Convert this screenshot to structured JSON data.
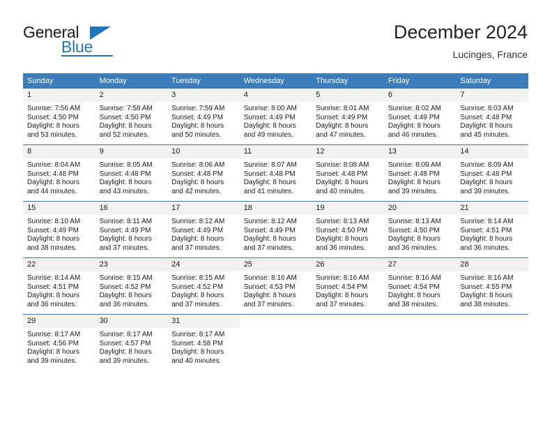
{
  "brand": {
    "name_part1": "General",
    "name_part2": "Blue",
    "accent_color": "#1f76bc"
  },
  "header": {
    "month_title": "December 2024",
    "location": "Lucinges, France"
  },
  "calendar": {
    "header_bg_color": "#3d7cba",
    "daynum_bg_color": "#f2f2f2",
    "weekday_headers": [
      "Sunday",
      "Monday",
      "Tuesday",
      "Wednesday",
      "Thursday",
      "Friday",
      "Saturday"
    ],
    "weeks": [
      [
        {
          "day": "1",
          "info": "Sunrise: 7:56 AM\nSunset: 4:50 PM\nDaylight: 8 hours\nand 53 minutes."
        },
        {
          "day": "2",
          "info": "Sunrise: 7:58 AM\nSunset: 4:50 PM\nDaylight: 8 hours\nand 52 minutes."
        },
        {
          "day": "3",
          "info": "Sunrise: 7:59 AM\nSunset: 4:49 PM\nDaylight: 8 hours\nand 50 minutes."
        },
        {
          "day": "4",
          "info": "Sunrise: 8:00 AM\nSunset: 4:49 PM\nDaylight: 8 hours\nand 49 minutes."
        },
        {
          "day": "5",
          "info": "Sunrise: 8:01 AM\nSunset: 4:49 PM\nDaylight: 8 hours\nand 47 minutes."
        },
        {
          "day": "6",
          "info": "Sunrise: 8:02 AM\nSunset: 4:49 PM\nDaylight: 8 hours\nand 46 minutes."
        },
        {
          "day": "7",
          "info": "Sunrise: 8:03 AM\nSunset: 4:48 PM\nDaylight: 8 hours\nand 45 minutes."
        }
      ],
      [
        {
          "day": "8",
          "info": "Sunrise: 8:04 AM\nSunset: 4:48 PM\nDaylight: 8 hours\nand 44 minutes."
        },
        {
          "day": "9",
          "info": "Sunrise: 8:05 AM\nSunset: 4:48 PM\nDaylight: 8 hours\nand 43 minutes."
        },
        {
          "day": "10",
          "info": "Sunrise: 8:06 AM\nSunset: 4:48 PM\nDaylight: 8 hours\nand 42 minutes."
        },
        {
          "day": "11",
          "info": "Sunrise: 8:07 AM\nSunset: 4:48 PM\nDaylight: 8 hours\nand 41 minutes."
        },
        {
          "day": "12",
          "info": "Sunrise: 8:08 AM\nSunset: 4:48 PM\nDaylight: 8 hours\nand 40 minutes."
        },
        {
          "day": "13",
          "info": "Sunrise: 8:09 AM\nSunset: 4:48 PM\nDaylight: 8 hours\nand 39 minutes."
        },
        {
          "day": "14",
          "info": "Sunrise: 8:09 AM\nSunset: 4:48 PM\nDaylight: 8 hours\nand 39 minutes."
        }
      ],
      [
        {
          "day": "15",
          "info": "Sunrise: 8:10 AM\nSunset: 4:49 PM\nDaylight: 8 hours\nand 38 minutes."
        },
        {
          "day": "16",
          "info": "Sunrise: 8:11 AM\nSunset: 4:49 PM\nDaylight: 8 hours\nand 37 minutes."
        },
        {
          "day": "17",
          "info": "Sunrise: 8:12 AM\nSunset: 4:49 PM\nDaylight: 8 hours\nand 37 minutes."
        },
        {
          "day": "18",
          "info": "Sunrise: 8:12 AM\nSunset: 4:49 PM\nDaylight: 8 hours\nand 37 minutes."
        },
        {
          "day": "19",
          "info": "Sunrise: 8:13 AM\nSunset: 4:50 PM\nDaylight: 8 hours\nand 36 minutes."
        },
        {
          "day": "20",
          "info": "Sunrise: 8:13 AM\nSunset: 4:50 PM\nDaylight: 8 hours\nand 36 minutes."
        },
        {
          "day": "21",
          "info": "Sunrise: 8:14 AM\nSunset: 4:51 PM\nDaylight: 8 hours\nand 36 minutes."
        }
      ],
      [
        {
          "day": "22",
          "info": "Sunrise: 8:14 AM\nSunset: 4:51 PM\nDaylight: 8 hours\nand 36 minutes."
        },
        {
          "day": "23",
          "info": "Sunrise: 8:15 AM\nSunset: 4:52 PM\nDaylight: 8 hours\nand 36 minutes."
        },
        {
          "day": "24",
          "info": "Sunrise: 8:15 AM\nSunset: 4:52 PM\nDaylight: 8 hours\nand 37 minutes."
        },
        {
          "day": "25",
          "info": "Sunrise: 8:16 AM\nSunset: 4:53 PM\nDaylight: 8 hours\nand 37 minutes."
        },
        {
          "day": "26",
          "info": "Sunrise: 8:16 AM\nSunset: 4:54 PM\nDaylight: 8 hours\nand 37 minutes."
        },
        {
          "day": "27",
          "info": "Sunrise: 8:16 AM\nSunset: 4:54 PM\nDaylight: 8 hours\nand 38 minutes."
        },
        {
          "day": "28",
          "info": "Sunrise: 8:16 AM\nSunset: 4:55 PM\nDaylight: 8 hours\nand 38 minutes."
        }
      ],
      [
        {
          "day": "29",
          "info": "Sunrise: 8:17 AM\nSunset: 4:56 PM\nDaylight: 8 hours\nand 39 minutes."
        },
        {
          "day": "30",
          "info": "Sunrise: 8:17 AM\nSunset: 4:57 PM\nDaylight: 8 hours\nand 39 minutes."
        },
        {
          "day": "31",
          "info": "Sunrise: 8:17 AM\nSunset: 4:58 PM\nDaylight: 8 hours\nand 40 minutes."
        },
        {
          "day": "",
          "info": ""
        },
        {
          "day": "",
          "info": ""
        },
        {
          "day": "",
          "info": ""
        },
        {
          "day": "",
          "info": ""
        }
      ]
    ]
  }
}
